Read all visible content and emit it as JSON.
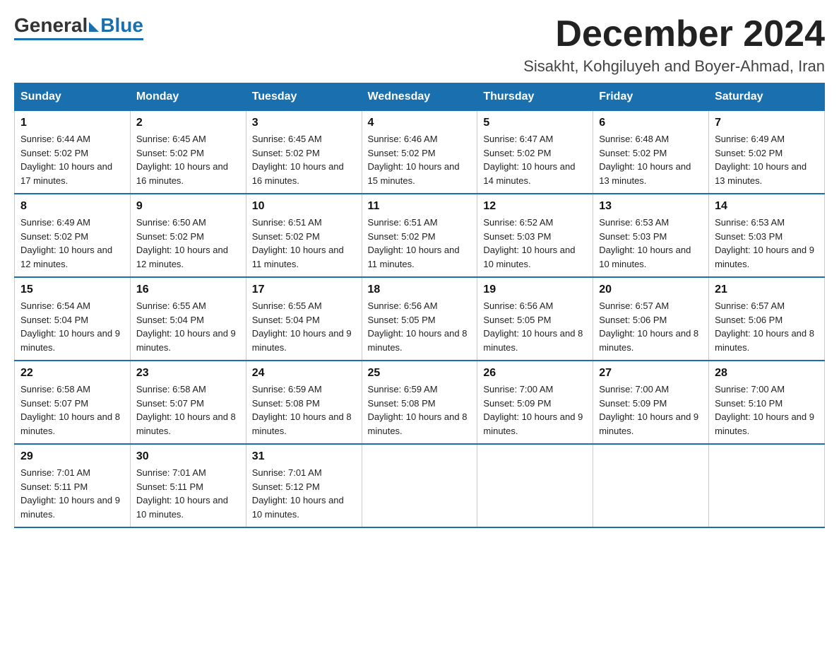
{
  "header": {
    "logo": {
      "general": "General",
      "blue": "Blue"
    },
    "month": "December 2024",
    "location": "Sisakht, Kohgiluyeh and Boyer-Ahmad, Iran"
  },
  "days_of_week": [
    "Sunday",
    "Monday",
    "Tuesday",
    "Wednesday",
    "Thursday",
    "Friday",
    "Saturday"
  ],
  "weeks": [
    [
      {
        "day": "1",
        "sunrise": "6:44 AM",
        "sunset": "5:02 PM",
        "daylight": "10 hours and 17 minutes."
      },
      {
        "day": "2",
        "sunrise": "6:45 AM",
        "sunset": "5:02 PM",
        "daylight": "10 hours and 16 minutes."
      },
      {
        "day": "3",
        "sunrise": "6:45 AM",
        "sunset": "5:02 PM",
        "daylight": "10 hours and 16 minutes."
      },
      {
        "day": "4",
        "sunrise": "6:46 AM",
        "sunset": "5:02 PM",
        "daylight": "10 hours and 15 minutes."
      },
      {
        "day": "5",
        "sunrise": "6:47 AM",
        "sunset": "5:02 PM",
        "daylight": "10 hours and 14 minutes."
      },
      {
        "day": "6",
        "sunrise": "6:48 AM",
        "sunset": "5:02 PM",
        "daylight": "10 hours and 13 minutes."
      },
      {
        "day": "7",
        "sunrise": "6:49 AM",
        "sunset": "5:02 PM",
        "daylight": "10 hours and 13 minutes."
      }
    ],
    [
      {
        "day": "8",
        "sunrise": "6:49 AM",
        "sunset": "5:02 PM",
        "daylight": "10 hours and 12 minutes."
      },
      {
        "day": "9",
        "sunrise": "6:50 AM",
        "sunset": "5:02 PM",
        "daylight": "10 hours and 12 minutes."
      },
      {
        "day": "10",
        "sunrise": "6:51 AM",
        "sunset": "5:02 PM",
        "daylight": "10 hours and 11 minutes."
      },
      {
        "day": "11",
        "sunrise": "6:51 AM",
        "sunset": "5:02 PM",
        "daylight": "10 hours and 11 minutes."
      },
      {
        "day": "12",
        "sunrise": "6:52 AM",
        "sunset": "5:03 PM",
        "daylight": "10 hours and 10 minutes."
      },
      {
        "day": "13",
        "sunrise": "6:53 AM",
        "sunset": "5:03 PM",
        "daylight": "10 hours and 10 minutes."
      },
      {
        "day": "14",
        "sunrise": "6:53 AM",
        "sunset": "5:03 PM",
        "daylight": "10 hours and 9 minutes."
      }
    ],
    [
      {
        "day": "15",
        "sunrise": "6:54 AM",
        "sunset": "5:04 PM",
        "daylight": "10 hours and 9 minutes."
      },
      {
        "day": "16",
        "sunrise": "6:55 AM",
        "sunset": "5:04 PM",
        "daylight": "10 hours and 9 minutes."
      },
      {
        "day": "17",
        "sunrise": "6:55 AM",
        "sunset": "5:04 PM",
        "daylight": "10 hours and 9 minutes."
      },
      {
        "day": "18",
        "sunrise": "6:56 AM",
        "sunset": "5:05 PM",
        "daylight": "10 hours and 8 minutes."
      },
      {
        "day": "19",
        "sunrise": "6:56 AM",
        "sunset": "5:05 PM",
        "daylight": "10 hours and 8 minutes."
      },
      {
        "day": "20",
        "sunrise": "6:57 AM",
        "sunset": "5:06 PM",
        "daylight": "10 hours and 8 minutes."
      },
      {
        "day": "21",
        "sunrise": "6:57 AM",
        "sunset": "5:06 PM",
        "daylight": "10 hours and 8 minutes."
      }
    ],
    [
      {
        "day": "22",
        "sunrise": "6:58 AM",
        "sunset": "5:07 PM",
        "daylight": "10 hours and 8 minutes."
      },
      {
        "day": "23",
        "sunrise": "6:58 AM",
        "sunset": "5:07 PM",
        "daylight": "10 hours and 8 minutes."
      },
      {
        "day": "24",
        "sunrise": "6:59 AM",
        "sunset": "5:08 PM",
        "daylight": "10 hours and 8 minutes."
      },
      {
        "day": "25",
        "sunrise": "6:59 AM",
        "sunset": "5:08 PM",
        "daylight": "10 hours and 8 minutes."
      },
      {
        "day": "26",
        "sunrise": "7:00 AM",
        "sunset": "5:09 PM",
        "daylight": "10 hours and 9 minutes."
      },
      {
        "day": "27",
        "sunrise": "7:00 AM",
        "sunset": "5:09 PM",
        "daylight": "10 hours and 9 minutes."
      },
      {
        "day": "28",
        "sunrise": "7:00 AM",
        "sunset": "5:10 PM",
        "daylight": "10 hours and 9 minutes."
      }
    ],
    [
      {
        "day": "29",
        "sunrise": "7:01 AM",
        "sunset": "5:11 PM",
        "daylight": "10 hours and 9 minutes."
      },
      {
        "day": "30",
        "sunrise": "7:01 AM",
        "sunset": "5:11 PM",
        "daylight": "10 hours and 10 minutes."
      },
      {
        "day": "31",
        "sunrise": "7:01 AM",
        "sunset": "5:12 PM",
        "daylight": "10 hours and 10 minutes."
      },
      null,
      null,
      null,
      null
    ]
  ],
  "labels": {
    "sunrise": "Sunrise:",
    "sunset": "Sunset:",
    "daylight": "Daylight:"
  }
}
